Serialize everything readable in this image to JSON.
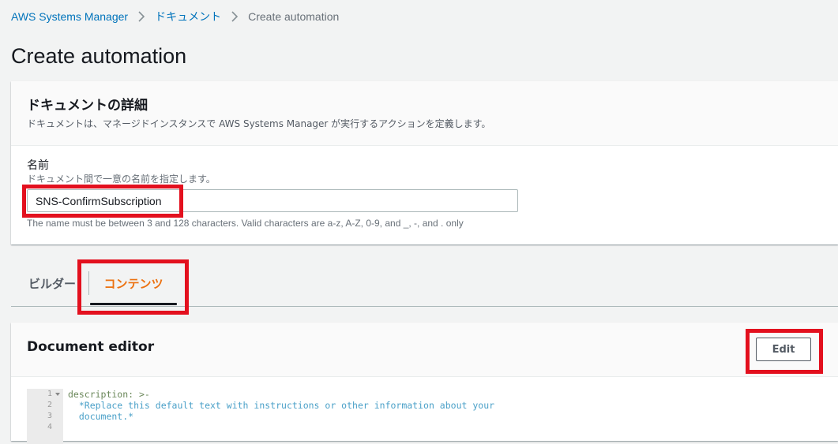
{
  "breadcrumb": {
    "items": [
      "AWS Systems Manager",
      "ドキュメント"
    ],
    "current": "Create automation"
  },
  "page": {
    "title": "Create automation"
  },
  "document_details": {
    "title": "ドキュメントの詳細",
    "description": "ドキュメントは、マネージドインスタンスで AWS Systems Manager が実行するアクションを定義します。",
    "name_field": {
      "label": "名前",
      "description": "ドキュメント間で一意の名前を指定します。",
      "value": "SNS-ConfirmSubscription",
      "constraint": "The name must be between 3 and 128 characters. Valid characters are a-z, A-Z, 0-9, and _, -, and . only"
    }
  },
  "tabs": {
    "items": [
      "ビルダー",
      "コンテンツ"
    ],
    "active": "コンテンツ"
  },
  "editor": {
    "title": "Document editor",
    "edit_label": "Edit",
    "line_numbers": [
      "1",
      "2",
      "3",
      "4"
    ],
    "lines": [
      "description: >-",
      "  *Replace this default text with instructions or other information about your",
      "  document.*",
      ""
    ]
  },
  "colors": {
    "link": "#0073bb",
    "active_tab": "#ec7211",
    "highlight": "#e3101e"
  },
  "icons": {
    "breadcrumb_separator": "chevron-right-icon",
    "fold": "fold-arrow-icon"
  }
}
